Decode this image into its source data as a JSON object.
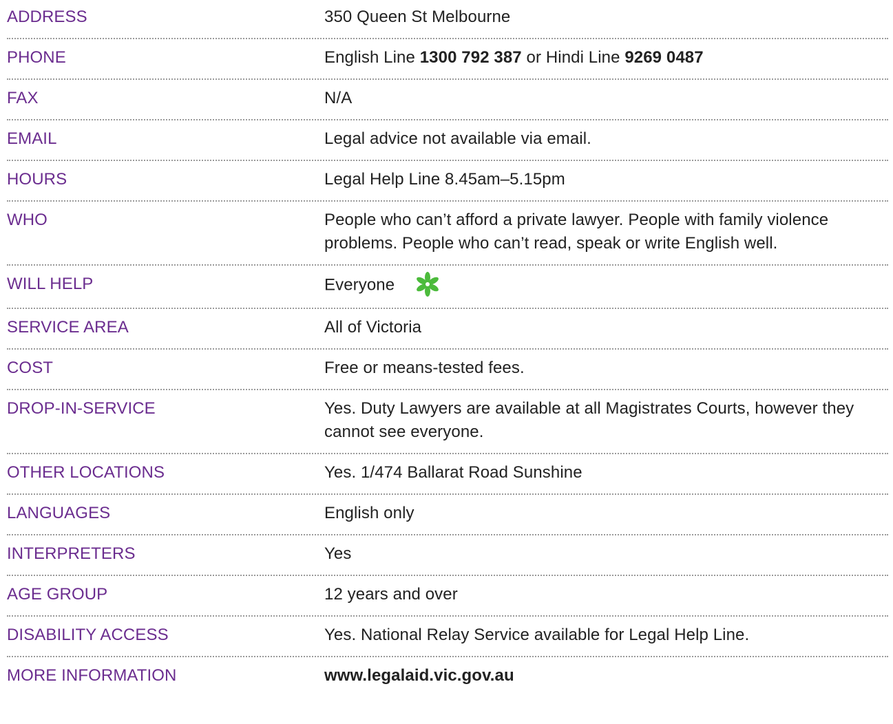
{
  "rows": [
    {
      "label": "ADDRESS",
      "value": "350 Queen St Melbourne"
    },
    {
      "label": "PHONE",
      "value_parts": [
        "English Line ",
        "1300 792 387",
        " or Hindi Line ",
        "9269 0487"
      ]
    },
    {
      "label": "FAX",
      "value": "N/A"
    },
    {
      "label": "EMAIL",
      "value": "Legal advice not available via email."
    },
    {
      "label": "HOURS",
      "value": "Legal Help Line 8.45am–5.15pm"
    },
    {
      "label": "WHO",
      "value": "People who can’t afford a private lawyer. People with family violence problems. People who can’t read, speak or write English well."
    },
    {
      "label": "WILL HELP",
      "value": "Everyone",
      "icon": "green-asterisk-icon"
    },
    {
      "label": "SERVICE AREA",
      "value": "All of Victoria"
    },
    {
      "label": "COST",
      "value": "Free or means-tested fees."
    },
    {
      "label": "DROP-IN-SERVICE",
      "value": "Yes. Duty Lawyers are available at all Magistrates Courts, however they cannot see everyone."
    },
    {
      "label": "OTHER LOCATIONS",
      "value": "Yes. 1/474 Ballarat Road Sunshine"
    },
    {
      "label": "LANGUAGES",
      "value": "English only"
    },
    {
      "label": "INTERPRETERS",
      "value": "Yes"
    },
    {
      "label": "AGE GROUP",
      "value": "12 years and over"
    },
    {
      "label": "DISABILITY ACCESS",
      "value": "Yes. National Relay Service available for Legal Help Line."
    },
    {
      "label": "MORE INFORMATION",
      "value": "www.legalaid.vic.gov.au"
    }
  ],
  "colors": {
    "label": "#6b2d8f",
    "text": "#222222",
    "divider": "#9a9a9a",
    "icon": "#4cbb3c"
  }
}
